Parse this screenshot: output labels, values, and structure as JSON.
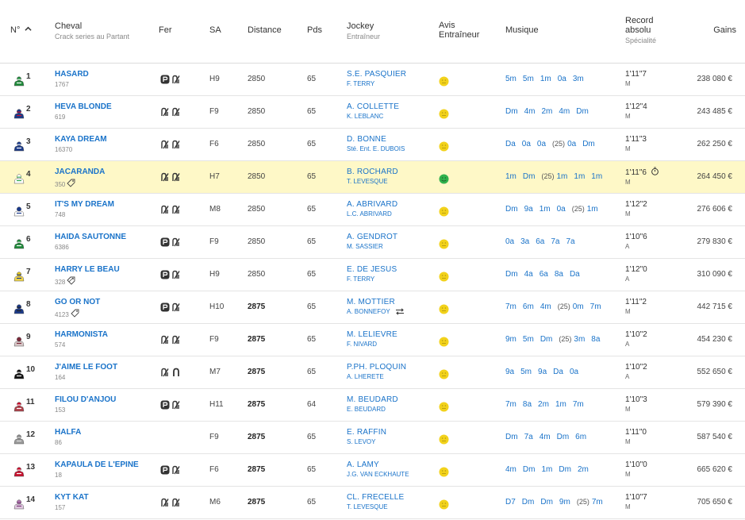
{
  "header": {
    "num": "N°",
    "cheval": "Cheval",
    "cheval_sub": "Crack series au Partant",
    "fer": "Fer",
    "sa": "SA",
    "distance": "Distance",
    "pds": "Pds",
    "jockey": "Jockey",
    "jockey_sub": "Entraîneur",
    "avis_1": "Avis",
    "avis_2": "Entraîneur",
    "musique": "Musique",
    "record_1": "Record",
    "record_2": "absolu",
    "record_sub": "Spécialité",
    "gains": "Gains"
  },
  "colors": {
    "link": "#1a73c9",
    "highlight_row": "#fef8c7",
    "avis_neutral": "#f2d21b",
    "avis_positive": "#2fb24d"
  },
  "rows": [
    {
      "num": "1",
      "silk": {
        "cap": "#1f8a3a",
        "body": "#1f8a3a",
        "trim": "#ffffff"
      },
      "name": "HASARD",
      "sub": "1767",
      "sub_icon": "",
      "fer": [
        "shoe-boxed-icon",
        "shoe-barefoot-icon"
      ],
      "sa": "H9",
      "distance": "2850",
      "dist_bold": false,
      "pds": "65",
      "jockey": "S.E. PASQUIER",
      "trainer": "F. TERRY",
      "swap": false,
      "avis": "neutral",
      "musique": [
        "5m",
        "5m",
        "1m",
        "0a",
        "3m"
      ],
      "record": "1'11\"7",
      "spec": "M",
      "clock": false,
      "gains": "238 080 €",
      "hl": false
    },
    {
      "num": "2",
      "silk": {
        "cap": "#1b3a8a",
        "body": "#1b3a8a",
        "trim": "#c8102e"
      },
      "name": "HEVA BLONDE",
      "sub": "619",
      "sub_icon": "",
      "fer": [
        "shoe-barefoot-icon",
        "shoe-barefoot-icon"
      ],
      "sa": "F9",
      "distance": "2850",
      "dist_bold": false,
      "pds": "65",
      "jockey": "A. COLLETTE",
      "trainer": "K. LEBLANC",
      "swap": false,
      "avis": "neutral",
      "musique": [
        "Dm",
        "4m",
        "2m",
        "4m",
        "Dm"
      ],
      "record": "1'12\"4",
      "spec": "M",
      "clock": false,
      "gains": "243 485 €",
      "hl": false
    },
    {
      "num": "3",
      "silk": {
        "cap": "#1b3a8a",
        "body": "#1b3a8a",
        "trim": "#ffffff"
      },
      "name": "KAYA DREAM",
      "sub": "16370",
      "sub_icon": "",
      "fer": [
        "shoe-barefoot-icon",
        "shoe-barefoot-icon"
      ],
      "sa": "F6",
      "distance": "2850",
      "dist_bold": false,
      "pds": "65",
      "jockey": "D. BONNE",
      "trainer": "Sté. Ent. E. DUBOIS",
      "swap": false,
      "avis": "neutral",
      "musique": [
        "Da",
        "0a",
        "0a",
        "(25)",
        "0a",
        "Dm"
      ],
      "record": "1'11\"3",
      "spec": "M",
      "clock": false,
      "gains": "262 250 €",
      "hl": false
    },
    {
      "num": "4",
      "silk": {
        "cap": "#ffffff",
        "body": "#ffffff",
        "trim": "#2fa84f"
      },
      "name": "JACARANDA",
      "sub": "350",
      "sub_icon": "tag-icon",
      "fer": [
        "shoe-barefoot-icon",
        "shoe-barefoot-icon"
      ],
      "sa": "H7",
      "distance": "2850",
      "dist_bold": false,
      "pds": "65",
      "jockey": "B. ROCHARD",
      "trainer": "T. LEVESQUE",
      "swap": false,
      "avis": "positive",
      "musique": [
        "1m",
        "Dm",
        "(25)",
        "1m",
        "1m",
        "1m"
      ],
      "record": "1'11\"6",
      "spec": "M",
      "clock": true,
      "gains": "264 450 €",
      "hl": true
    },
    {
      "num": "5",
      "silk": {
        "cap": "#1b3a8a",
        "body": "#ffffff",
        "trim": "#1b3a8a"
      },
      "name": "IT'S MY DREAM",
      "sub": "748",
      "sub_icon": "",
      "fer": [
        "shoe-barefoot-icon",
        "shoe-barefoot-icon"
      ],
      "sa": "M8",
      "distance": "2850",
      "dist_bold": false,
      "pds": "65",
      "jockey": "A. ABRIVARD",
      "trainer": "L.C. ABRIVARD",
      "swap": false,
      "avis": "neutral",
      "musique": [
        "Dm",
        "9a",
        "1m",
        "0a",
        "(25)",
        "1m"
      ],
      "record": "1'12\"2",
      "spec": "M",
      "clock": false,
      "gains": "276 606 €",
      "hl": false
    },
    {
      "num": "6",
      "silk": {
        "cap": "#1f8a3a",
        "body": "#1f8a3a",
        "trim": "#ffffff"
      },
      "name": "HAIDA SAUTONNE",
      "sub": "6386",
      "sub_icon": "",
      "fer": [
        "shoe-boxed-icon",
        "shoe-barefoot-icon"
      ],
      "sa": "F9",
      "distance": "2850",
      "dist_bold": false,
      "pds": "65",
      "jockey": "A. GENDROT",
      "trainer": "M. SASSIER",
      "swap": false,
      "avis": "neutral",
      "musique": [
        "0a",
        "3a",
        "6a",
        "7a",
        "7a"
      ],
      "record": "1'10\"6",
      "spec": "A",
      "clock": false,
      "gains": "279 830 €",
      "hl": false
    },
    {
      "num": "7",
      "silk": {
        "cap": "#e8c81a",
        "body": "#f2d64b",
        "trim": "#1b3a8a"
      },
      "name": "HARRY LE BEAU",
      "sub": "328",
      "sub_icon": "tag-multi-icon",
      "fer": [
        "shoe-boxed-icon",
        "shoe-barefoot-icon"
      ],
      "sa": "H9",
      "distance": "2850",
      "dist_bold": false,
      "pds": "65",
      "jockey": "E. DE JESUS",
      "trainer": "F. TERRY",
      "swap": false,
      "avis": "neutral",
      "musique": [
        "Dm",
        "4a",
        "6a",
        "8a",
        "Da"
      ],
      "record": "1'12\"0",
      "spec": "A",
      "clock": false,
      "gains": "310 090 €",
      "hl": false
    },
    {
      "num": "8",
      "silk": {
        "cap": "#1b3a8a",
        "body": "#1b3a8a",
        "trim": "#222222"
      },
      "name": "GO OR NOT",
      "sub": "4123",
      "sub_icon": "tag-icon",
      "fer": [
        "shoe-boxed-icon",
        "shoe-barefoot-icon"
      ],
      "sa": "H10",
      "distance": "2875",
      "dist_bold": true,
      "pds": "65",
      "jockey": "M. MOTTIER",
      "trainer": "A. BONNEFOY",
      "swap": true,
      "avis": "neutral",
      "musique": [
        "7m",
        "6m",
        "4m",
        "(25)",
        "0m",
        "7m"
      ],
      "record": "1'11\"2",
      "spec": "M",
      "clock": false,
      "gains": "442 715 €",
      "hl": false
    },
    {
      "num": "9",
      "silk": {
        "cap": "#7a2a3a",
        "body": "#d8c8c8",
        "trim": "#7a2a3a"
      },
      "name": "HARMONISTA",
      "sub": "574",
      "sub_icon": "",
      "fer": [
        "shoe-barefoot-icon",
        "shoe-barefoot-icon"
      ],
      "sa": "F9",
      "distance": "2875",
      "dist_bold": true,
      "pds": "65",
      "jockey": "M. LELIEVRE",
      "trainer": "F. NIVARD",
      "swap": false,
      "avis": "neutral",
      "musique": [
        "9m",
        "5m",
        "Dm",
        "(25)",
        "3m",
        "8a"
      ],
      "record": "1'10\"2",
      "spec": "A",
      "clock": false,
      "gains": "454 230 €",
      "hl": false
    },
    {
      "num": "10",
      "silk": {
        "cap": "#111111",
        "body": "#111111",
        "trim": "#ffffff"
      },
      "name": "J'AIME LE FOOT",
      "sub": "164",
      "sub_icon": "",
      "fer": [
        "shoe-barefoot-icon",
        "shoe-horseshoe-icon"
      ],
      "sa": "M7",
      "distance": "2875",
      "dist_bold": true,
      "pds": "65",
      "jockey": "P.PH. PLOQUIN",
      "trainer": "A. LHERETE",
      "swap": false,
      "avis": "neutral",
      "musique": [
        "9a",
        "5m",
        "9a",
        "Da",
        "0a"
      ],
      "record": "1'10\"2",
      "spec": "A",
      "clock": false,
      "gains": "552 650 €",
      "hl": false
    },
    {
      "num": "11",
      "silk": {
        "cap": "#c8102e",
        "body": "#b0404a",
        "trim": "#ffffff"
      },
      "name": "FILOU D'ANJOU",
      "sub": "153",
      "sub_icon": "",
      "fer": [
        "shoe-boxed-icon",
        "shoe-barefoot-icon"
      ],
      "sa": "H11",
      "distance": "2875",
      "dist_bold": true,
      "pds": "64",
      "jockey": "M. BEUDARD",
      "trainer": "E. BEUDARD",
      "swap": false,
      "avis": "neutral",
      "musique": [
        "7m",
        "8a",
        "2m",
        "1m",
        "7m"
      ],
      "record": "1'10\"3",
      "spec": "M",
      "clock": false,
      "gains": "579 390 €",
      "hl": false
    },
    {
      "num": "12",
      "silk": {
        "cap": "#8a8a8a",
        "body": "#9a9a9a",
        "trim": "#dddddd"
      },
      "name": "HALFA",
      "sub": "86",
      "sub_icon": "",
      "fer": [],
      "sa": "F9",
      "distance": "2875",
      "dist_bold": true,
      "pds": "65",
      "jockey": "E. RAFFIN",
      "trainer": "S. LEVOY",
      "swap": false,
      "avis": "neutral",
      "musique": [
        "Dm",
        "7a",
        "4m",
        "Dm",
        "6m"
      ],
      "record": "1'11\"0",
      "spec": "M",
      "clock": false,
      "gains": "587 540 €",
      "hl": false
    },
    {
      "num": "13",
      "silk": {
        "cap": "#c8102e",
        "body": "#c8102e",
        "trim": "#ffffff"
      },
      "name": "KAPAULA DE L'EPINE",
      "sub": "18",
      "sub_icon": "",
      "fer": [
        "shoe-boxed-icon",
        "shoe-barefoot-icon"
      ],
      "sa": "F6",
      "distance": "2875",
      "dist_bold": true,
      "pds": "65",
      "jockey": "A. LAMY",
      "trainer": "J.G. VAN ECKHAUTE",
      "swap": false,
      "avis": "neutral",
      "musique": [
        "4m",
        "Dm",
        "1m",
        "Dm",
        "2m"
      ],
      "record": "1'10\"0",
      "spec": "M",
      "clock": false,
      "gains": "665 620 €",
      "hl": false
    },
    {
      "num": "14",
      "silk": {
        "cap": "#b07ab0",
        "body": "#e0c8e0",
        "trim": "#7a3a7a"
      },
      "name": "KYT KAT",
      "sub": "157",
      "sub_icon": "",
      "fer": [
        "shoe-barefoot-icon",
        "shoe-barefoot-icon"
      ],
      "sa": "M6",
      "distance": "2875",
      "dist_bold": true,
      "pds": "65",
      "jockey": "CL. FRECELLE",
      "trainer": "T. LEVESQUE",
      "swap": false,
      "avis": "neutral",
      "musique": [
        "D7",
        "Dm",
        "Dm",
        "9m",
        "(25)",
        "7m"
      ],
      "record": "1'10\"7",
      "spec": "M",
      "clock": false,
      "gains": "705 650 €",
      "hl": false
    }
  ]
}
